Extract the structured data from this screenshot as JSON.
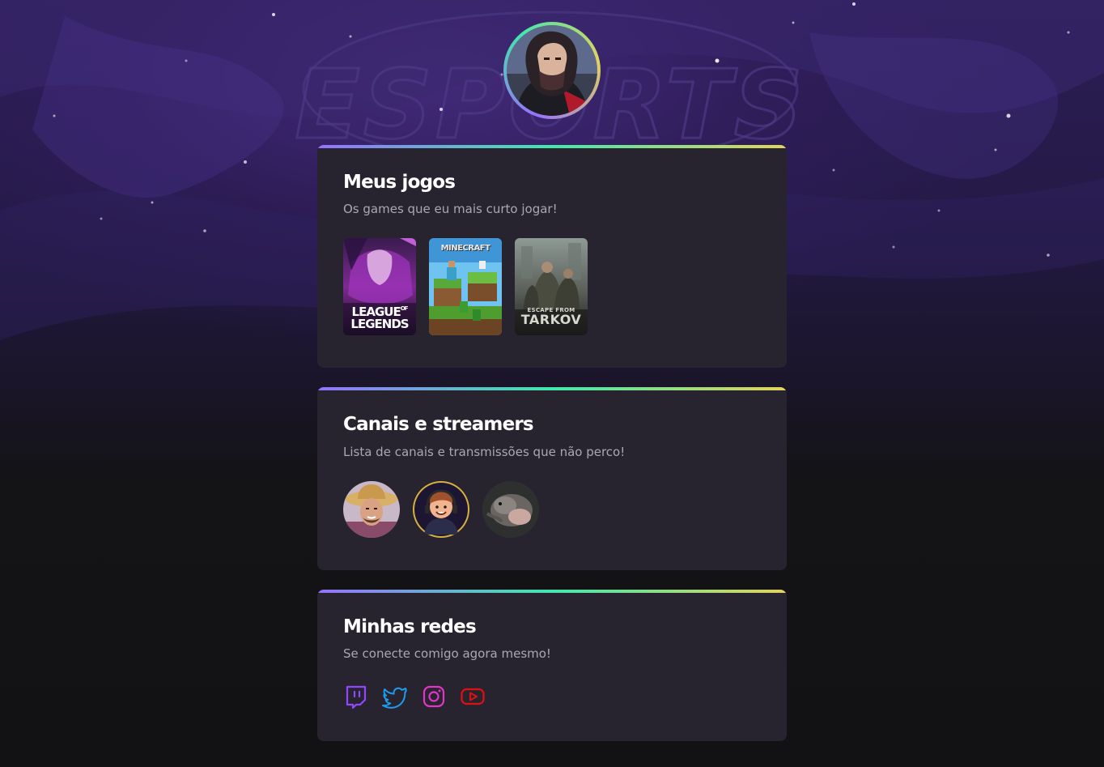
{
  "profile": {
    "avatar_icon": "hooded-character-avatar"
  },
  "background": {
    "watermark": "ESPORTS",
    "colors": {
      "top": "#2c1d55",
      "bottom": "#121214"
    }
  },
  "gradient_colors": [
    "#9572fc",
    "#43e7ad",
    "#e2d45c"
  ],
  "games_card": {
    "title": "Meus jogos",
    "subtitle": "Os games que eu mais curto jogar!",
    "games": [
      {
        "name": "League of Legends",
        "line1": "LEAGUE",
        "line1_small": "OF",
        "line2": "LEGENDS"
      },
      {
        "name": "Minecraft",
        "label": "MINECRAFT"
      },
      {
        "name": "Escape from Tarkov",
        "line1": "ESCAPE FROM",
        "line2": "TARKOV"
      }
    ]
  },
  "streamers_card": {
    "title": "Canais e streamers",
    "subtitle": "Lista de canais e transmissões que não perco!",
    "streamers": [
      {
        "icon": "streamer-avatar-straw-hat"
      },
      {
        "icon": "streamer-avatar-cartoon-headset"
      },
      {
        "icon": "streamer-avatar-animal"
      }
    ]
  },
  "social_card": {
    "title": "Minhas redes",
    "subtitle": "Se conecte comigo agora mesmo!",
    "links": [
      {
        "icon": "twitch-icon",
        "color": "#9146ff"
      },
      {
        "icon": "twitter-icon",
        "color": "#1d9bf0"
      },
      {
        "icon": "instagram-icon",
        "color": "#e1306c"
      },
      {
        "icon": "youtube-icon",
        "color": "#ff0000"
      }
    ]
  }
}
